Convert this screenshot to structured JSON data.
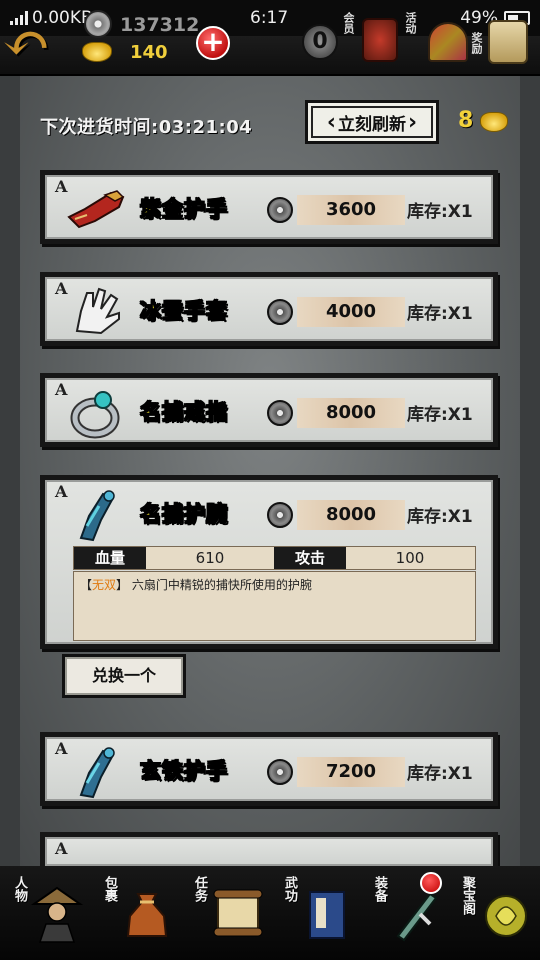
{
  "status_bar": {
    "network_speed": "0.00KB/s",
    "time": "6:17",
    "battery": "49%"
  },
  "top_bar": {
    "silver": "137312",
    "gold": "140",
    "vip_level": "0",
    "vip_label": "会员",
    "drum_label": "活动",
    "fan_label": "奖励",
    "scroll_label": "公告"
  },
  "shop": {
    "next_refresh_label": "下次进货时间:03:21:04",
    "refresh_button": "立刻刷新",
    "refresh_cost": "8",
    "items": [
      {
        "grade": "A",
        "name": "紫金护手",
        "price": "3600",
        "stock": "库存:X1"
      },
      {
        "grade": "A",
        "name": "冰蚕手套",
        "price": "4000",
        "stock": "库存:X1"
      },
      {
        "grade": "A",
        "name": "名捕戒指",
        "price": "8000",
        "stock": "库存:X1"
      },
      {
        "grade": "A",
        "name": "名捕护腕",
        "price": "8000",
        "stock": "库存:X1"
      },
      {
        "grade": "A",
        "name": "玄铁护手",
        "price": "7200",
        "stock": "库存:X1"
      },
      {
        "grade": "A"
      }
    ],
    "detail": {
      "stat1_label": "血量",
      "stat1_value": "610",
      "stat2_label": "攻击",
      "stat2_value": "100",
      "tag_open": "【",
      "tag": "无双",
      "tag_close": "】",
      "description": "六扇门中精锐的捕快所使用的护腕"
    },
    "exchange_button": "兑换一个"
  },
  "bottom_nav": [
    {
      "label": "人物"
    },
    {
      "label": "包裹"
    },
    {
      "label": "任务"
    },
    {
      "label": "武功"
    },
    {
      "label": "装备"
    },
    {
      "label": "聚宝阁"
    }
  ]
}
